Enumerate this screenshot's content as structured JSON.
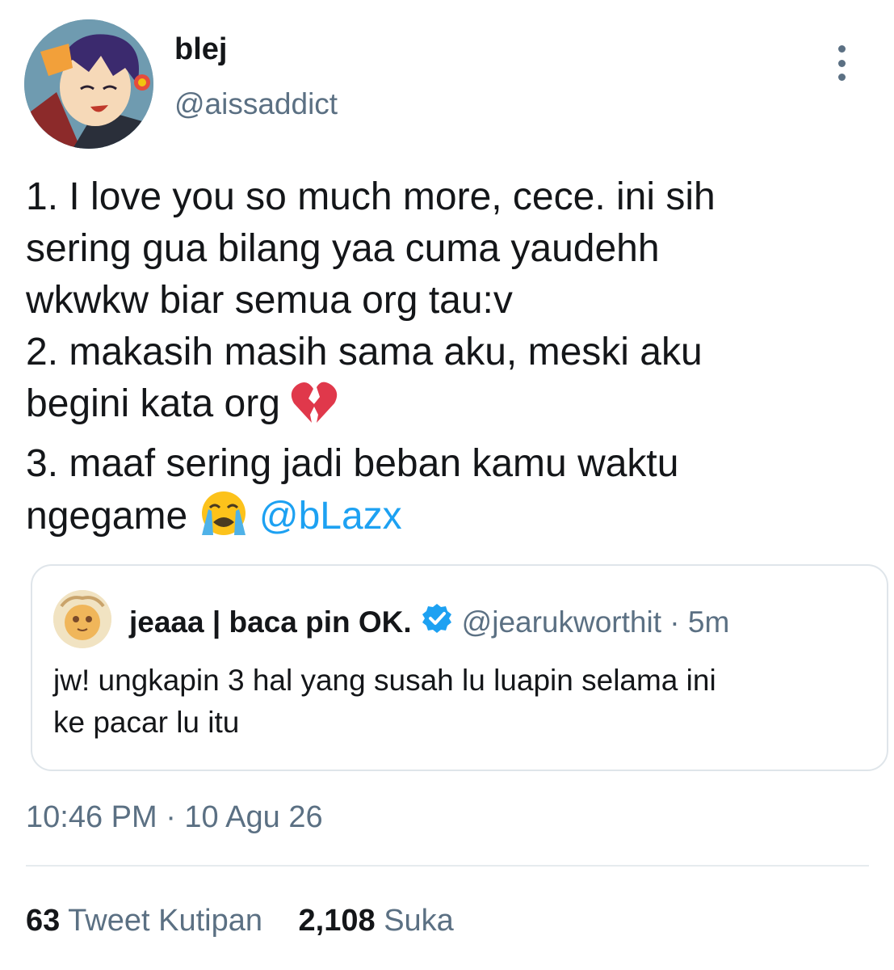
{
  "author": {
    "display_name": "blej",
    "handle": "@aissaddict"
  },
  "tweet": {
    "lines": [
      "1. I love you so much more, cece. ini sih",
      "sering gua bilang yaa cuma yaudehh",
      "wkwkw biar semua org tau:v",
      "2. makasih masih sama aku, meski aku",
      "begini kata org",
      "3. maaf sering jadi beban kamu waktu",
      "ngegame"
    ],
    "emoji_broken_heart": "broken-heart-emoji",
    "emoji_crying": "loudly-crying-face-emoji",
    "mention": "@bLazx"
  },
  "quoted_tweet": {
    "display_name": "jeaaa | baca pin OK.",
    "handle_time": "@jearukworthit · 5m",
    "lines": [
      "jw! ungkapin 3 hal yang susah lu luapin selama ini",
      "ke pacar lu itu"
    ]
  },
  "timestamp": "10:46 PM · 10 Agu 26",
  "stats": {
    "quote_count": "63",
    "quote_label": "Tweet Kutipan",
    "like_count": "2,108",
    "like_label": "Suka"
  },
  "colors": {
    "accent": "#1da1f2",
    "secondary_text": "#5b7083",
    "primary_text": "#141619",
    "border": "#dfe5ea"
  }
}
